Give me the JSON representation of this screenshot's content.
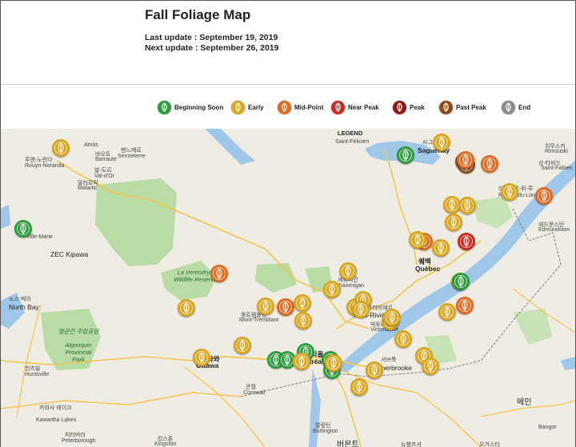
{
  "header": {
    "title": "Fall Foliage Map",
    "last_update": "Last update : September 19, 2019",
    "next_update": "Next update : September 26, 2019"
  },
  "legend": [
    {
      "label": "Beginning Soon",
      "color": "#2e9b3e"
    },
    {
      "label": "Early",
      "color": "#d9a61f"
    },
    {
      "label": "Mid-Point",
      "color": "#e06a1f"
    },
    {
      "label": "Near Peak",
      "color": "#cc2a1e"
    },
    {
      "label": "Peak",
      "color": "#8c1a12"
    },
    {
      "label": "Past Peak",
      "color": "#8a4a1a"
    },
    {
      "label": "End",
      "color": "#8a8a8a"
    }
  ],
  "map": {
    "legend_label": "LEGEND",
    "labels": [
      "Amos",
      "루앤-노란다",
      "Rouyn-Noranda",
      "바오트",
      "Barraute",
      "벤느떼르",
      "Senneterre",
      "발-도르",
      "Val-d'Or",
      "말라르틱",
      "Malartic",
      "Saint-Félicien",
      "사그네",
      "Saguenay",
      "히무스키",
      "Rimouski",
      "상-타비드",
      "Saint-Fabien",
      "리비에르-뒤-루",
      "Rivière-du-Loup",
      "에드문스턴",
      "Edmundston",
      "Ville-Marie",
      "ZEC Kipawa",
      "La Verendrye Wildlife Reserve",
      "노스 베이",
      "North Bay",
      "셰위니건",
      "Shawinigan",
      "퀘벡",
      "Québec",
      "트루아리비에르",
      "Trois-Rivières",
      "빅토리아빌",
      "Victoriaville",
      "몽트렘블랑",
      "Mont-Tremblant",
      "알곤킨 주립공원",
      "Algonquin Provincial Park",
      "오타와",
      "Ottawa",
      "몬트리올",
      "Montréal",
      "셔브룩",
      "Sherbrooke",
      "헌츠빌",
      "Huntsville",
      "콘월",
      "Cornwall",
      "카와사 레이크",
      "Kawartha Lakes",
      "피터버러",
      "Peterborough",
      "킹스톤",
      "Kingston",
      "벌링턴",
      "Burlington",
      "버몬트",
      "메인",
      "Bangor",
      "오거스타",
      "뉴햄프셔"
    ],
    "markers": [
      {
        "status": "Early"
      },
      {
        "status": "Beginning Soon"
      },
      {
        "status": "Beginning Soon"
      },
      {
        "status": "Early"
      },
      {
        "status": "Past Peak"
      },
      {
        "status": "Past Peak"
      },
      {
        "status": "Mid-Point"
      },
      {
        "status": "Mid-Point"
      },
      {
        "status": "Early"
      },
      {
        "status": "Early"
      },
      {
        "status": "Mid-Point"
      },
      {
        "status": "Early"
      },
      {
        "status": "Early"
      },
      {
        "status": "Mid-Point"
      },
      {
        "status": "Early"
      },
      {
        "status": "Early"
      },
      {
        "status": "Near Peak"
      },
      {
        "status": "Early"
      },
      {
        "status": "Early"
      },
      {
        "status": "Mid-Point"
      },
      {
        "status": "Beginning Soon"
      },
      {
        "status": "Early"
      },
      {
        "status": "Mid-Point"
      },
      {
        "status": "Mid-Point"
      },
      {
        "status": "Early"
      },
      {
        "status": "Early"
      },
      {
        "status": "Early"
      },
      {
        "status": "Early"
      },
      {
        "status": "Early"
      },
      {
        "status": "Early"
      },
      {
        "status": "Early"
      },
      {
        "status": "Early"
      },
      {
        "status": "Early"
      },
      {
        "status": "Early"
      },
      {
        "status": "Early"
      },
      {
        "status": "Early"
      },
      {
        "status": "Early"
      },
      {
        "status": "Beginning Soon"
      },
      {
        "status": "Beginning Soon"
      },
      {
        "status": "Beginning Soon"
      },
      {
        "status": "Beginning Soon"
      },
      {
        "status": "Beginning Soon"
      },
      {
        "status": "Early"
      },
      {
        "status": "Early"
      },
      {
        "status": "Early"
      },
      {
        "status": "Early"
      },
      {
        "status": "Early"
      },
      {
        "status": "Early"
      }
    ]
  }
}
